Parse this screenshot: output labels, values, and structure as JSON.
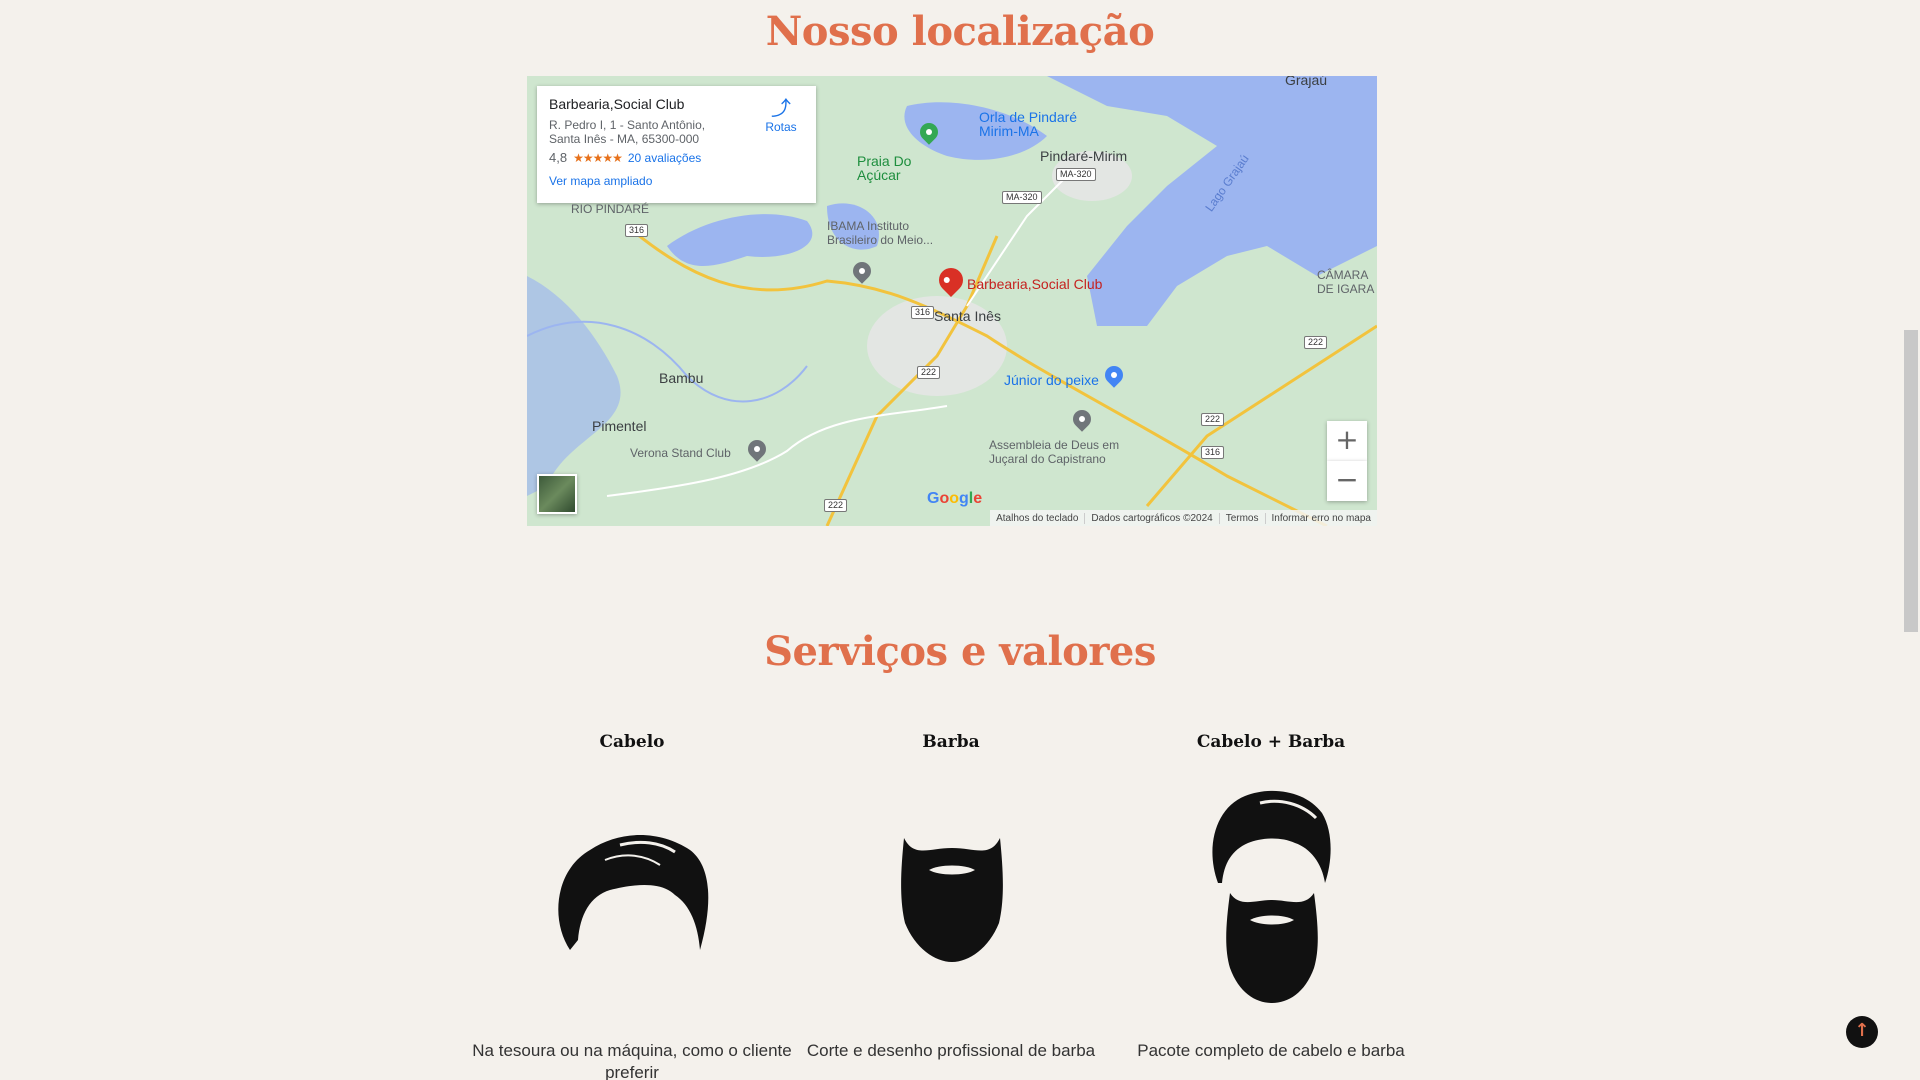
{
  "sections": {
    "location_title": "Nosso localização",
    "services_title": "Serviços e valores"
  },
  "map": {
    "place_name": "Barbearia,Social Club",
    "address": "R. Pedro I, 1 - Santo Antônio, Santa Inês - MA, 65300-000",
    "rating": "4,8",
    "stars": "★★★★★",
    "reviews": "20 avaliações",
    "bigger_map": "Ver mapa ampliado",
    "directions": "Rotas",
    "labels": {
      "grajau": "Grajaú",
      "praia": "Praia Do\nAçúcar",
      "orla": "Orla de Pindaré\nMirim-MA",
      "pindare_mirim": "Pindaré-Mirim",
      "lago": "Lago Grajaú",
      "rio_pindare": "RIO PINDARÉ",
      "ibama": "IBAMA Instituto\nBrasileiro do Meio...",
      "barbearia": "Barbearia,Social Club",
      "santa_ines": "Santa Inês",
      "camara": "CÂMARA\nDE IGARA",
      "bambu": "Bambu",
      "junior": "Júnior do peixe",
      "pimentel": "Pimentel",
      "assembleia": "Assembleia de Deus em\nJuçaral do Capistrano",
      "verona": "Verona Stand Club",
      "rio_pindare_river": "Rio Pindaré",
      "rio_pindare_river2": "Rio Pindaré"
    },
    "shields": [
      "MA-320",
      "MA-320",
      "316",
      "316",
      "222",
      "222",
      "222",
      "316",
      "222"
    ],
    "zoom_in": "+",
    "zoom_out": "−",
    "google": "Google",
    "attribution": [
      "Atalhos do teclado",
      "Dados cartográficos ©2024",
      "Termos",
      "Informar erro no mapa"
    ]
  },
  "services": [
    {
      "title": "Cabelo",
      "desc": "Na tesoura ou na máquina, como o cliente preferir"
    },
    {
      "title": "Barba",
      "desc": "Corte e desenho profissional de barba"
    },
    {
      "title": "Cabelo + Barba",
      "desc": "Pacote completo de cabelo e barba"
    }
  ],
  "back_to_top": "↑",
  "colors": {
    "accent": "#e0704c",
    "background": "#f4f1ec",
    "water": "#9cb5f0",
    "land": "#cfe6cf"
  }
}
